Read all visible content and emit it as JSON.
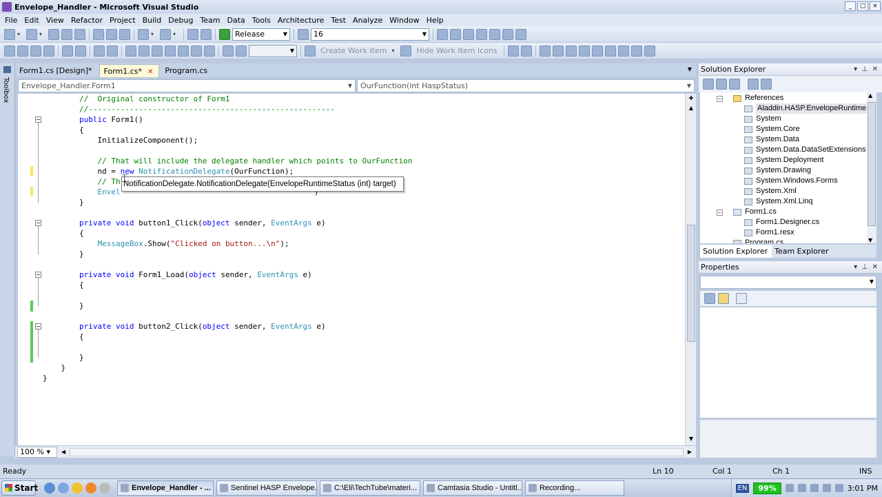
{
  "window": {
    "title": "Envelope_Handler - Microsoft Visual Studio"
  },
  "menu": [
    "File",
    "Edit",
    "View",
    "Refactor",
    "Project",
    "Build",
    "Debug",
    "Team",
    "Data",
    "Tools",
    "Architecture",
    "Test",
    "Analyze",
    "Window",
    "Help"
  ],
  "toolbar": {
    "configuration": "Release",
    "find_value": "16",
    "create_work_item": "Create Work Item",
    "hide_work_item_icons": "Hide Work Item Icons"
  },
  "toolbox": {
    "label": "Toolbox"
  },
  "tabs": [
    {
      "label": "Form1.cs [Design]*",
      "active": false
    },
    {
      "label": "Form1.cs*",
      "active": true
    },
    {
      "label": "Program.cs",
      "active": false
    }
  ],
  "navbar": {
    "type": "Envelope_Handler.Form1",
    "member": "OurFunction(int HaspStatus)"
  },
  "code": {
    "l1": "        //  Original constructor of Form1",
    "l2": "        //------------------------------------------------------",
    "l3a": "        ",
    "l3kw": "public",
    "l3b": " Form1()",
    "l4": "        {",
    "l5": "            InitializeComponent();",
    "l6": "            // That will include the delegate handler which points to OurFunction",
    "l7a": "            nd = ",
    "l7kw": "new",
    "l7ty": " NotificationDelegate",
    "l7b": "(OurFunction);",
    "l8": "            // Th",
    "l9": "            Envel",
    "l9tail": ")",
    "l10": "        }",
    "l11a": "        ",
    "l11kw1": "private",
    "l11kw2": " void",
    "l11b": " button1_Click(",
    "l11kw3": "object",
    "l11c": " sender, ",
    "l11ty": "EventArgs",
    "l11d": " e)",
    "l12": "        {",
    "l13a": "            ",
    "l13ty": "MessageBox",
    "l13b": ".Show(",
    "l13st": "\"Clicked on button...\\n\"",
    "l13c": ");",
    "l14": "        }",
    "l15a": "        ",
    "l15kw1": "private",
    "l15kw2": " void",
    "l15b": " Form1_Load(",
    "l15kw3": "object",
    "l15c": " sender, ",
    "l15ty": "EventArgs",
    "l15d": " e)",
    "l16": "        {",
    "l17": "        }",
    "l18a": "        ",
    "l18kw1": "private",
    "l18kw2": " void",
    "l18b": " button2_Click(",
    "l18kw3": "object",
    "l18c": " sender, ",
    "l18ty": "EventArgs",
    "l18d": " e)",
    "l19": "        {",
    "l20": "        }",
    "l21": "    }",
    "l22": "}"
  },
  "tooltip": "NotificationDelegate.NotificationDelegate(EnvelopeRuntimeStatus (int) target)",
  "editor": {
    "zoom": "100 %"
  },
  "solution_explorer": {
    "title": "Solution Explorer",
    "items": [
      {
        "label": "References"
      },
      {
        "label": "Aladdin.HASP.EnvelopeRuntime"
      },
      {
        "label": "System"
      },
      {
        "label": "System.Core"
      },
      {
        "label": "System.Data"
      },
      {
        "label": "System.Data.DataSetExtensions"
      },
      {
        "label": "System.Deployment"
      },
      {
        "label": "System.Drawing"
      },
      {
        "label": "System.Windows.Forms"
      },
      {
        "label": "System.Xml"
      },
      {
        "label": "System.Xml.Linq"
      },
      {
        "label": "Form1.cs"
      },
      {
        "label": "Form1.Designer.cs"
      },
      {
        "label": "Form1.resx"
      },
      {
        "label": "Program.cs"
      }
    ],
    "tab_solution": "Solution Explorer",
    "tab_team": "Team Explorer"
  },
  "properties": {
    "title": "Properties"
  },
  "status": {
    "ready": "Ready",
    "ln": "Ln 10",
    "col": "Col 1",
    "ch": "Ch 1",
    "ins": "INS"
  },
  "taskbar": {
    "start": "Start",
    "tasks": [
      "Envelope_Handler - ...",
      "Sentinel HASP Envelope...",
      "C:\\Eli\\TechTube\\materi...",
      "Camtasia Studio - Untitl...",
      "Recording..."
    ],
    "lang": "EN",
    "battery": "99%",
    "clock": "3:01 PM"
  }
}
